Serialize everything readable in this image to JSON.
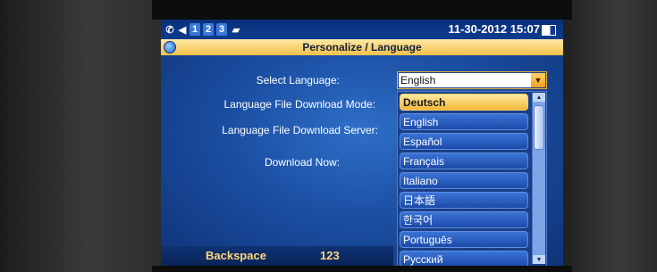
{
  "statusbar": {
    "icons": [
      "phone-icon",
      "volume-icon",
      "1",
      "2",
      "3",
      "folder-icon"
    ],
    "datetime": "11-30-2012 15:07"
  },
  "header": {
    "title": "Personalize / Language"
  },
  "form": {
    "select_language_label": "Select Language:",
    "download_mode_label": "Language File Download Mode:",
    "download_server_label": "Language File Download Server:",
    "download_now_label": "Download Now:",
    "select_language_value": "English"
  },
  "dropdown": {
    "options": [
      "Deutsch",
      "English",
      "Español",
      "Français",
      "Italiano",
      "日本語",
      "한국어",
      "Português",
      "Русский"
    ],
    "highlighted_index": 0
  },
  "softkeys": {
    "left": "Backspace",
    "right": "123"
  },
  "colors": {
    "accent": "#f2b73a",
    "screen_bg": "#1b4fa3"
  }
}
